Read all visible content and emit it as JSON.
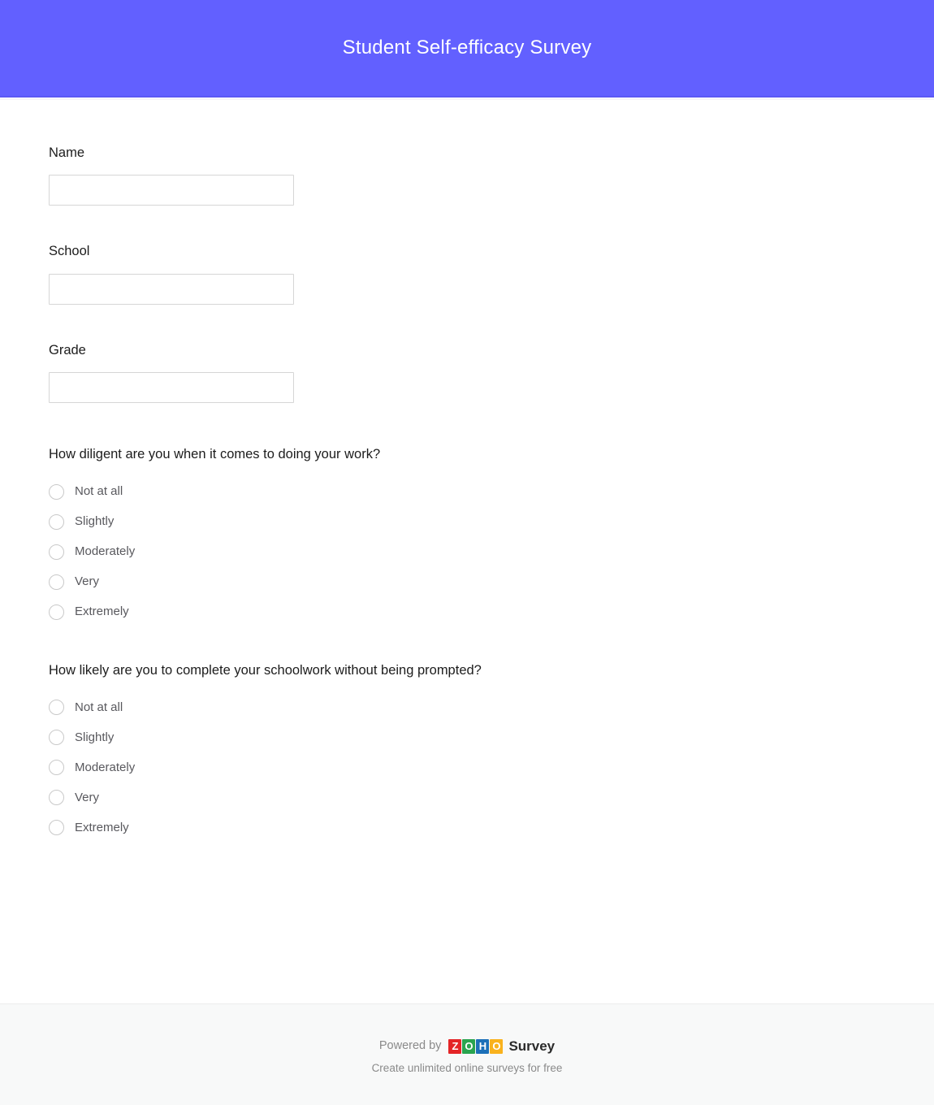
{
  "header": {
    "title": "Student Self-efficacy Survey",
    "background_color": "#6260FF",
    "title_color": "#FFFFFF"
  },
  "form": {
    "text_fields": [
      {
        "label": "Name",
        "value": "",
        "placeholder": ""
      },
      {
        "label": "School",
        "value": "",
        "placeholder": ""
      },
      {
        "label": "Grade",
        "value": "",
        "placeholder": ""
      }
    ],
    "questions": [
      {
        "title": "How diligent are you when it comes to doing your work?",
        "type": "radio",
        "selected": null,
        "options": [
          {
            "label": "Not at all"
          },
          {
            "label": "Slightly"
          },
          {
            "label": "Moderately"
          },
          {
            "label": "Very"
          },
          {
            "label": "Extremely"
          }
        ]
      },
      {
        "title": "How likely are you to complete your schoolwork without being prompted?",
        "type": "radio",
        "selected": null,
        "options": [
          {
            "label": "Not at all"
          },
          {
            "label": "Slightly"
          },
          {
            "label": "Moderately"
          },
          {
            "label": "Very"
          },
          {
            "label": "Extremely"
          }
        ]
      }
    ]
  },
  "footer": {
    "powered_by": "Powered by",
    "brand_letters": [
      {
        "char": "Z",
        "color": "#E42527"
      },
      {
        "char": "O",
        "color": "#2AA44F"
      },
      {
        "char": "H",
        "color": "#1C70B8"
      },
      {
        "char": "O",
        "color": "#F9B21D"
      }
    ],
    "product_word": "Survey",
    "tagline": "Create unlimited online surveys for free",
    "background_color": "#F8F9F9"
  }
}
